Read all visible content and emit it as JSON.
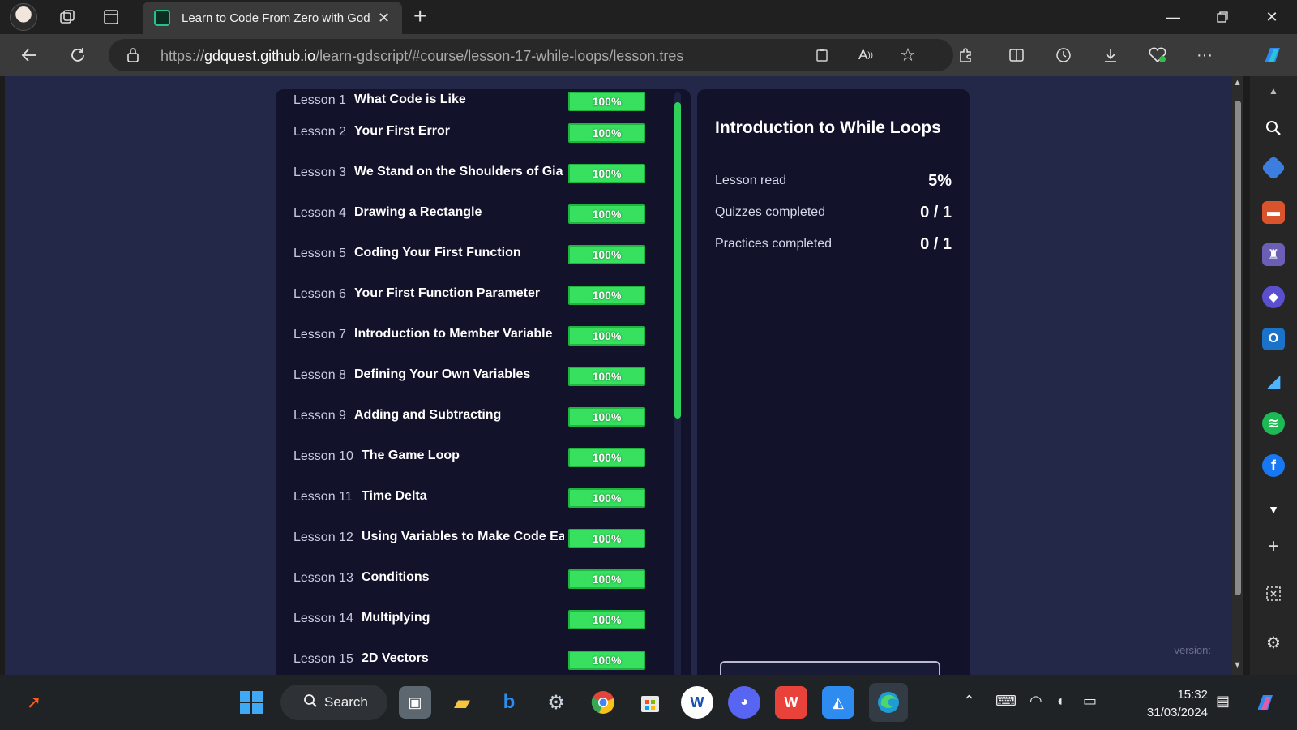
{
  "browser": {
    "tab_title": "Learn to Code From Zero with Godot",
    "url_prefix": "https://",
    "url_host": "gdquest.github.io",
    "url_path": "/learn-gdscript/#course/lesson-17-while-loops/lesson.tres"
  },
  "lessons": [
    {
      "num": "Lesson 1",
      "name": "What Code is Like",
      "progress": "100%"
    },
    {
      "num": "Lesson 2",
      "name": "Your First Error",
      "progress": "100%"
    },
    {
      "num": "Lesson 3",
      "name": "We Stand on the Shoulders of Gia",
      "progress": "100%"
    },
    {
      "num": "Lesson 4",
      "name": "Drawing a Rectangle",
      "progress": "100%"
    },
    {
      "num": "Lesson 5",
      "name": "Coding Your First Function",
      "progress": "100%"
    },
    {
      "num": "Lesson 6",
      "name": "Your First Function Parameter",
      "progress": "100%"
    },
    {
      "num": "Lesson 7",
      "name": "Introduction to Member Variable",
      "progress": "100%"
    },
    {
      "num": "Lesson 8",
      "name": "Defining Your Own Variables",
      "progress": "100%"
    },
    {
      "num": "Lesson 9",
      "name": "Adding and Subtracting",
      "progress": "100%"
    },
    {
      "num": "Lesson 10",
      "name": "The Game Loop",
      "progress": "100%"
    },
    {
      "num": "Lesson 11",
      "name": "Time Delta",
      "progress": "100%"
    },
    {
      "num": "Lesson 12",
      "name": "Using Variables to Make Code Ea",
      "progress": "100%"
    },
    {
      "num": "Lesson 13",
      "name": "Conditions",
      "progress": "100%"
    },
    {
      "num": "Lesson 14",
      "name": "Multiplying",
      "progress": "100%"
    },
    {
      "num": "Lesson 15",
      "name": "2D Vectors",
      "progress": "100%"
    }
  ],
  "info": {
    "title": "Introduction to While Loops",
    "stats": [
      {
        "label": "Lesson read",
        "value": "5%"
      },
      {
        "label": "Quizzes completed",
        "value": "0 / 1"
      },
      {
        "label": "Practices completed",
        "value": "0 / 1"
      }
    ],
    "version_label": "version:"
  },
  "taskbar": {
    "search_label": "Search",
    "time": "15:32",
    "date": "31/03/2024"
  },
  "colors": {
    "page_bg": "#232848",
    "panel_bg": "#12132a",
    "badge_green": "#37e05f"
  }
}
